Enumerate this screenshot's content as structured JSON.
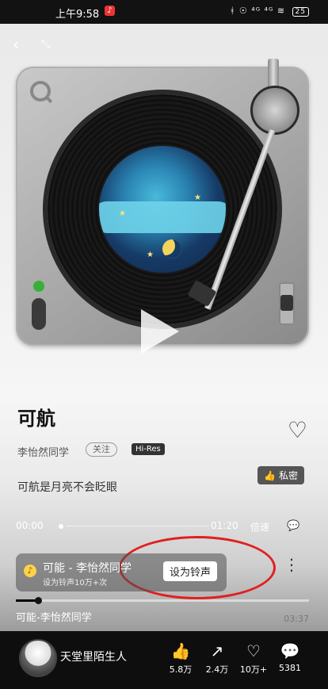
{
  "status_bar": {
    "time": "上午9:58",
    "battery": "25",
    "signal": "ᚼ ☉ ⁴ᴳ ⁴ᴳ ≋"
  },
  "song": {
    "title": "可航",
    "artist": "李怡然同学",
    "follow_label": "关注",
    "quality_badge": "Hi-Res",
    "lyric": "可航是月亮不会眨眼",
    "private_label": "私密"
  },
  "player": {
    "current_time": "00:00",
    "total_time": "01:20",
    "speed_label": "倍速"
  },
  "ringtone": {
    "title": "可能 - 李怡然同学",
    "subtitle": "设为铃声10万+次",
    "button_label": "设为铃声"
  },
  "mini": {
    "song": "可能-李怡然同学",
    "time": "03:37",
    "progress_fraction": 0.07
  },
  "user": {
    "name": "天堂里陌生人"
  },
  "stats": {
    "likes": "5.8万",
    "shares": "2.4万",
    "favorites": "10万+",
    "comments": "5381"
  },
  "colors": {
    "annotation_ellipse": "#e02020",
    "led": "#37b037",
    "battery_note": "#e33333"
  },
  "icons": [
    "back-icon",
    "collapse-icon",
    "play-icon",
    "heart-icon",
    "like-icon",
    "share-icon",
    "favorite-icon",
    "comment-icon",
    "more-icon"
  ]
}
